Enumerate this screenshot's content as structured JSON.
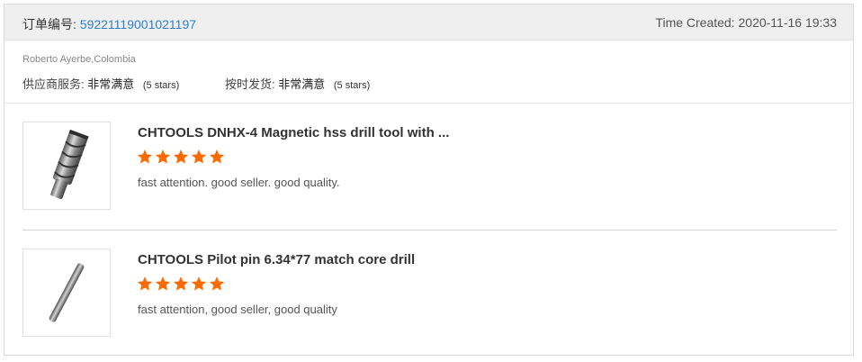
{
  "order": {
    "number_label": "订单编号:",
    "number": "59221119001021197",
    "created_label": "Time Created:",
    "created_value": "2020-11-16 19:33"
  },
  "buyer": {
    "name": "Roberto Ayerbe,Colombia"
  },
  "ratings": {
    "service": {
      "label": "供应商服务:",
      "value": "非常满意",
      "stars_note": "(5 stars)",
      "stars": 5
    },
    "shipping": {
      "label": "按时发货:",
      "value": "非常满意",
      "stars_note": "(5 stars)",
      "stars": 5
    }
  },
  "items": [
    {
      "title": "CHTOOLS DNHX-4 Magnetic hss drill tool with ...",
      "stars": 5,
      "review": "fast attention. good seller. good quality.",
      "image_icon": "annular-cutter-drill-image"
    },
    {
      "title": "CHTOOLS Pilot pin 6.34*77 match core drill",
      "stars": 5,
      "review": "fast attention, good seller, good quality",
      "image_icon": "pilot-pin-image"
    }
  ],
  "colors": {
    "star": "#ff6a00",
    "link": "#2a7fd4",
    "header_bg": "#efefef"
  }
}
